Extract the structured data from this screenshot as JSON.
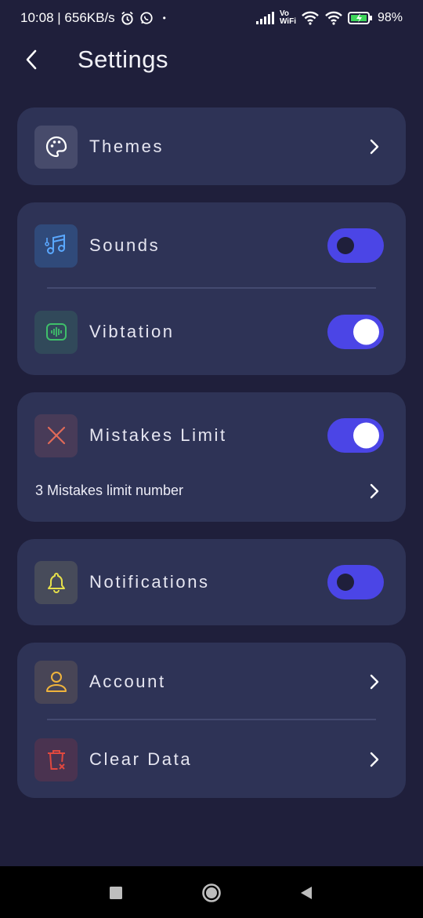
{
  "status_bar": {
    "time": "10:08 | 656KB/s",
    "dot": "•",
    "network": "Vo\nWiFi",
    "battery": "98%"
  },
  "header": {
    "title": "Settings"
  },
  "settings": {
    "themes": {
      "label": "Themes",
      "icon": "palette-icon"
    },
    "sounds": {
      "label": "Sounds",
      "icon": "music-note-icon",
      "enabled": false
    },
    "vibration": {
      "label": "Vibtation",
      "icon": "vibration-icon",
      "enabled": true
    },
    "mistakes_limit": {
      "label": "Mistakes Limit",
      "icon": "close-x-icon",
      "enabled": true,
      "sub_label": "3 Mistakes limit number"
    },
    "notifications": {
      "label": "Notifications",
      "icon": "bell-icon",
      "enabled": false
    },
    "account": {
      "label": "Account",
      "icon": "user-icon"
    },
    "clear_data": {
      "label": "Clear Data",
      "icon": "trash-icon"
    }
  },
  "colors": {
    "background": "#1f1f3b",
    "card": "#2e3356",
    "toggle_accent": "#4b45e6",
    "sounds_icon": "#5aa8ff",
    "vibration_icon": "#3fbf6a",
    "mistakes_icon": "#e06a58",
    "notifications_icon": "#e6e04a",
    "account_icon": "#f0b43c",
    "clear_data_icon": "#e0483f"
  }
}
